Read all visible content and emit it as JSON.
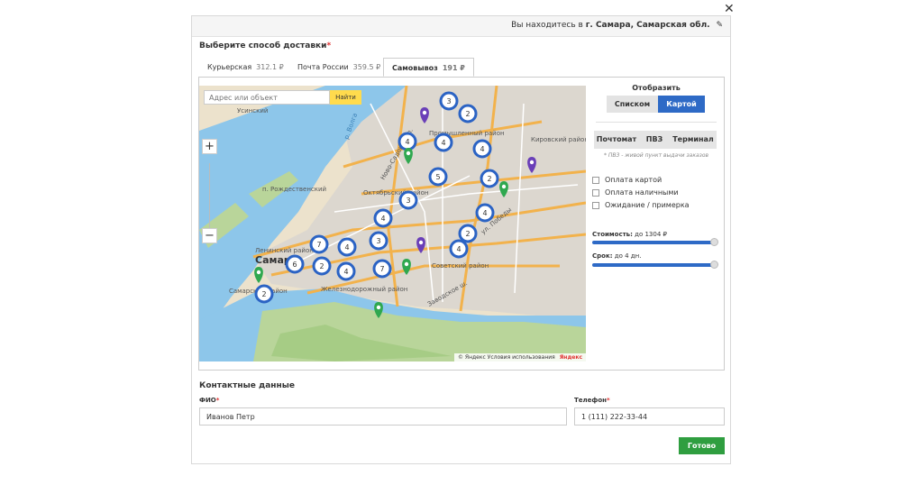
{
  "modal": {
    "close_icon": "close-icon"
  },
  "location": {
    "prefix": "Вы находитесь в",
    "city": "г. Самара, Самарская обл.",
    "edit_icon": "pencil-icon"
  },
  "delivery": {
    "title": "Выберите способ доставки",
    "required_mark": "*",
    "tabs": [
      {
        "label": "Курьерская",
        "price": "312.1 ₽",
        "active": false
      },
      {
        "label": "Почта России",
        "price": "359.5 ₽",
        "active": false
      },
      {
        "label": "Самовывоз",
        "price": "191 ₽",
        "active": true
      }
    ]
  },
  "map": {
    "search_placeholder": "Адрес или объект",
    "search_button": "Найти",
    "zoom_in": "+",
    "zoom_out": "−",
    "copyright": "© Яндекс Условия использования",
    "logo": "Яндекс",
    "labels": [
      {
        "text": "Усинский"
      },
      {
        "text": "Промышленный район"
      },
      {
        "text": "Кировский район"
      },
      {
        "text": "Октябрьский район"
      },
      {
        "text": "п. Рождественский"
      },
      {
        "text": "Ленинский район"
      },
      {
        "text": "Самара"
      },
      {
        "text": "Самарский район"
      },
      {
        "text": "Железнодорожный район"
      },
      {
        "text": "Советский район"
      },
      {
        "text": "Ново-Садовая ул."
      },
      {
        "text": "ул. Победы"
      },
      {
        "text": "р. Волга"
      },
      {
        "text": "Заводское ш."
      }
    ],
    "clusters": [
      "3",
      "2",
      "4",
      "4",
      "4",
      "5",
      "2",
      "3",
      "4",
      "4",
      "2",
      "4",
      "3",
      "7",
      "4",
      "6",
      "2",
      "4",
      "7",
      "2"
    ],
    "pin_colors": {
      "purple": "#6a3fb8",
      "green": "#2fa84f"
    },
    "cluster_color": "#2b63c4"
  },
  "sidebar": {
    "show_label": "Отобразить",
    "view_list": "Списком",
    "view_map": "Картой",
    "filters": [
      "Почтомат",
      "ПВЗ",
      "Терминал"
    ],
    "note": "* ПВЗ - живой пункт выдачи заказов",
    "checkboxes": [
      "Оплата картой",
      "Оплата наличными",
      "Ожидание / примерка"
    ],
    "cost_label": "Стоимость:",
    "cost_value": "до 1304 ₽",
    "term_label": "Срок:",
    "term_value": "до 4 дн."
  },
  "contacts": {
    "title": "Контактные данные",
    "name_label": "ФИО",
    "name_value": "Иванов Петр",
    "phone_label": "Телефон",
    "phone_value": "1 (111) 222-33-44",
    "required_mark": "*",
    "submit": "Готово"
  },
  "colors": {
    "accent": "#2e6ac6",
    "success": "#2f9e40",
    "required": "#e03030"
  }
}
